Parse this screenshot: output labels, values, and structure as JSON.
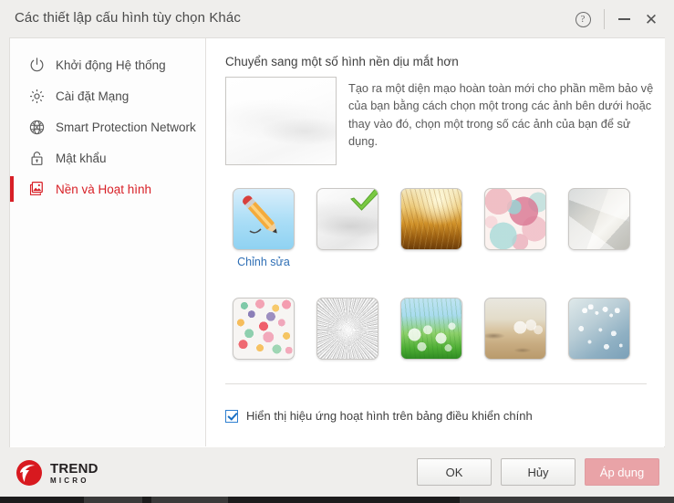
{
  "window": {
    "title": "Các thiết lập cấu hình tùy chọn Khác",
    "help_icon": "help-circle-icon",
    "minimize_icon": "minimize-icon",
    "close_icon": "close-icon"
  },
  "sidebar": {
    "items": [
      {
        "label": "Khởi động Hệ thống",
        "icon": "power-icon",
        "selected": false
      },
      {
        "label": "Cài đặt Mạng",
        "icon": "gear-icon",
        "selected": false
      },
      {
        "label": "Smart Protection Network",
        "icon": "globe-network-icon",
        "selected": false
      },
      {
        "label": "Mật khẩu",
        "icon": "lock-icon",
        "selected": false
      },
      {
        "label": "Nền và Hoạt hình",
        "icon": "photos-icon",
        "selected": true
      }
    ],
    "selected_color": "#d81f26"
  },
  "content": {
    "heading": "Chuyển sang một số hình nền dịu mắt hơn",
    "description": "Tạo ra một diện mạo hoàn toàn mới cho phần mềm bảo vệ của bạn bằng cách chọn một trong các ảnh bên dưới hoặc thay vào đó, chọn một trong số các ảnh của bạn để sử dụng.",
    "preview_name": "background-preview",
    "thumbnails": [
      {
        "id": "edit-custom",
        "art": "art-edit",
        "label": "Chỉnh sửa",
        "selected": false,
        "icon": "pencil-icon"
      },
      {
        "id": "plain-white",
        "art": "art-blank",
        "label": "",
        "selected": true,
        "icon": ""
      },
      {
        "id": "wheat-sunset",
        "art": "art-wheat",
        "label": "",
        "selected": false,
        "icon": ""
      },
      {
        "id": "pastel-circles",
        "art": "art-circles",
        "label": "",
        "selected": false,
        "icon": ""
      },
      {
        "id": "gray-polygons",
        "art": "art-poly",
        "label": "",
        "selected": false,
        "icon": ""
      },
      {
        "id": "confetti-dots",
        "art": "art-confetti",
        "label": "",
        "selected": false,
        "icon": ""
      },
      {
        "id": "brushed-metal",
        "art": "art-metal",
        "label": "",
        "selected": false,
        "icon": ""
      },
      {
        "id": "green-grass",
        "art": "art-grass",
        "label": "",
        "selected": false,
        "icon": ""
      },
      {
        "id": "sandy-beach",
        "art": "art-beach",
        "label": "",
        "selected": false,
        "icon": ""
      },
      {
        "id": "blue-blossoms",
        "art": "art-blossom",
        "label": "",
        "selected": false,
        "icon": ""
      }
    ],
    "checkbox": {
      "label": "Hiển thị hiệu ứng hoạt hình trên bảng điều khiển chính",
      "checked": true
    }
  },
  "footer": {
    "logo": {
      "line1": "TREND",
      "line2": "MICRO"
    },
    "buttons": {
      "ok": "OK",
      "cancel": "Hủy",
      "apply": "Áp dụng"
    }
  },
  "colors": {
    "brand_red": "#d81f26",
    "apply_pink": "#e9a3a7",
    "link_blue": "#2f6fb5",
    "window_bg": "#efeeec"
  }
}
